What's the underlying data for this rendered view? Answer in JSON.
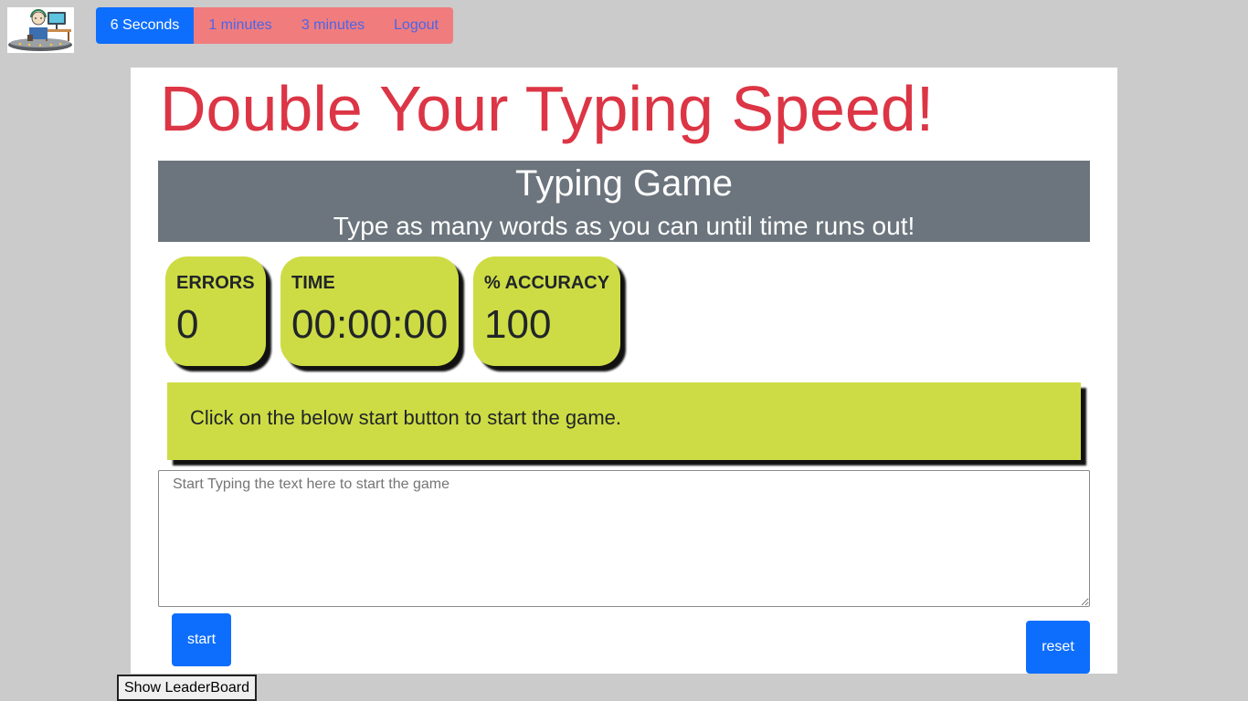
{
  "nav": {
    "logo_icon": "typist-at-desk-icon",
    "buttons": [
      {
        "label": "6 Seconds",
        "active": true
      },
      {
        "label": "1 minutes",
        "active": false
      },
      {
        "label": "3 minutes",
        "active": false
      },
      {
        "label": "Logout",
        "active": false
      }
    ]
  },
  "main": {
    "headline": "Double Your Typing Speed!",
    "banner": {
      "title": "Typing Game",
      "subtitle": "Type as many words as you can until time runs out!"
    },
    "stats": [
      {
        "label": "ERRORS",
        "value": "0"
      },
      {
        "label": "TIME",
        "value": "00:00:00"
      },
      {
        "label": "% ACCURACY",
        "value": "100"
      }
    ],
    "quote": "Click on the below start button to start the game.",
    "input": {
      "value": "",
      "placeholder": "Start Typing the text here to start the game"
    },
    "start_label": "start",
    "reset_label": "reset"
  },
  "footer": {
    "leaderboard_label": "Show LeaderBoard"
  },
  "colors": {
    "page_background": "#cbcbcb",
    "headline": "#dc3545",
    "banner": "#6c757d",
    "stat_card": "#cddc44",
    "primary_button": "#0d6efd",
    "nav_idle_button": "#f07c7e"
  }
}
